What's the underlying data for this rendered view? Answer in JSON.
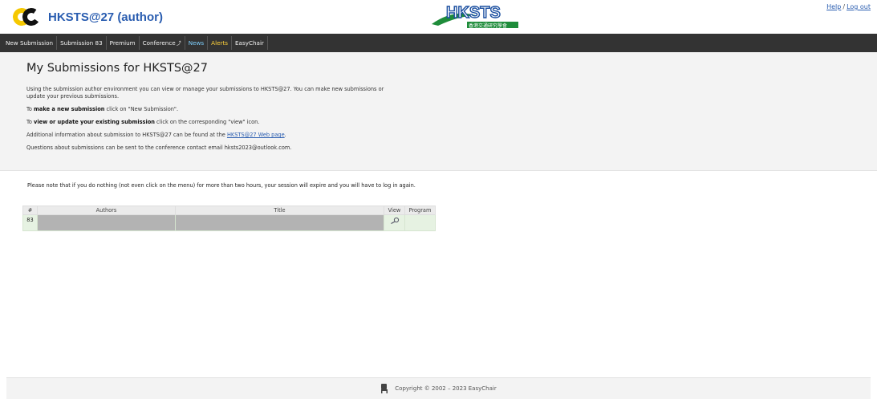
{
  "app": {
    "title": "HKSTS@27 (author)",
    "logo_name": "easychair-logo",
    "sponsor_logo_name": "hksts-logo"
  },
  "top_links": {
    "help": "Help",
    "separator": "/",
    "logout": "Log out"
  },
  "menu": {
    "items": [
      {
        "label": "New Submission"
      },
      {
        "label": "Submission 83"
      },
      {
        "label": "Premium"
      },
      {
        "label": "Conference"
      },
      {
        "label": "News"
      },
      {
        "label": "Alerts"
      },
      {
        "label": "EasyChair"
      }
    ]
  },
  "main": {
    "heading": "My Submissions for HKSTS@27",
    "intro": "Using the submission author environment you can view or manage your submissions to HKSTS@27. You can make new submissions or update your previous submissions.",
    "new_prefix": "To ",
    "new_bold": "make a new submission",
    "new_suffix": " click on \"New Submission\".",
    "update_prefix": "To ",
    "update_bold": "view or update your existing submission",
    "update_suffix": " click on the corresponding \"view\" icon.",
    "additional_prefix": "Additional information about submission to HKSTS@27 can be found at the ",
    "additional_link": "HKSTS@27 Web page",
    "additional_suffix": ".",
    "questions": "Questions about submissions can be sent to the conference contact email hksts2023@outlook.com."
  },
  "session_note": "Please note that if you do nothing (not even click on the menu) for more than two hours, your session will expire and you will have to log in again.",
  "table": {
    "headers": [
      "#",
      "Authors",
      "Title",
      "View",
      "Program"
    ],
    "rows": [
      {
        "num": "83",
        "authors": "",
        "title": "",
        "view_icon": "magnifier-icon",
        "program": ""
      }
    ]
  },
  "footer": {
    "copyright": "Copyright © 2002 – 2023 EasyChair",
    "icon": "chair-icon"
  },
  "colors": {
    "menubar": "#333333",
    "link": "#2a5db0",
    "news": "#7fd0ff",
    "alerts": "#ffd23a",
    "row_bg": "#e6f2e2",
    "redacted": "#b3b3b3"
  }
}
